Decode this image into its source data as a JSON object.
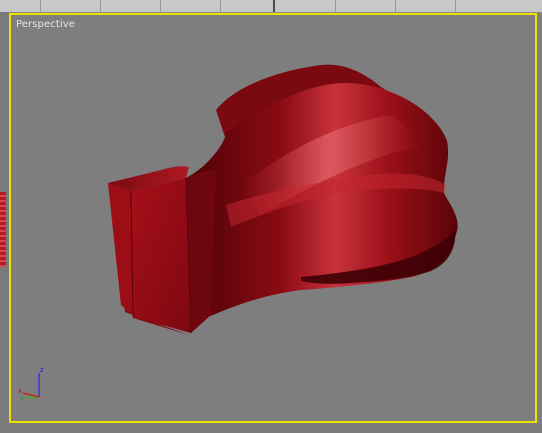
{
  "viewport": {
    "label": "Perspective",
    "active_border_color": "#f0e000",
    "background_color": "#7e7e7e"
  },
  "object": {
    "name": "red twisted box",
    "color": "#b3141e"
  },
  "axis_gizmo": {
    "x_label": "x",
    "y_label": "y",
    "z_label": "z"
  }
}
